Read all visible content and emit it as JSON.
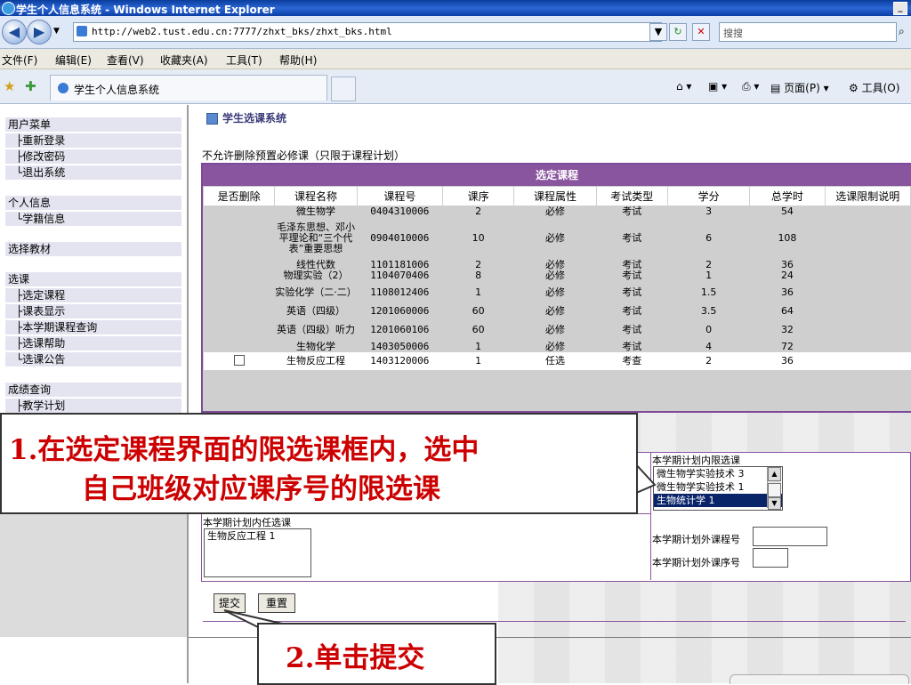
{
  "window": {
    "title": "学生个人信息系统 - Windows Internet Explorer"
  },
  "address": {
    "url": "http://web2.tust.edu.cn:7777/zhxt_bks/zhxt_bks.html",
    "search_placeholder": "搜搜"
  },
  "menubar": [
    "文件(F)",
    "编辑(E)",
    "查看(V)",
    "收藏夹(A)",
    "工具(T)",
    "帮助(H)"
  ],
  "tab": {
    "label": "学生个人信息系统"
  },
  "toolbar_right": {
    "page": "页面(P)",
    "tools": "工具(O)"
  },
  "sidebar": {
    "user_menu": "用户菜单",
    "relogin": "├重新登录",
    "change_pwd": "├修改密码",
    "logout": "└退出系统",
    "personal": "个人信息",
    "roll": "└学籍信息",
    "textbook": "选择教材",
    "course_select": "选课",
    "selected": "├选定课程",
    "timetable": "├课表显示",
    "term_query": "├本学期课程查询",
    "help": "├选课帮助",
    "notice": "└选课公告",
    "grades": "成绩查询",
    "plan": "├教学计划"
  },
  "main": {
    "section_title": "学生选课系统",
    "note": "不允许删除预置必修课（只限于课程计划）",
    "table_caption": "选定课程",
    "headers": [
      "是否删除",
      "课程名称",
      "课程号",
      "课序",
      "课程属性",
      "考试类型",
      "学分",
      "总学时",
      "选课限制说明"
    ],
    "rows": [
      {
        "name": "微生物学",
        "code": "0404310006",
        "seq": "2",
        "attr": "必修",
        "exam": "考试",
        "credit": "3",
        "hours": "54"
      },
      {
        "name": "毛泽东思想、邓小平理论和“三个代表”重要思想",
        "code": "0904010006",
        "seq": "10",
        "attr": "必修",
        "exam": "考试",
        "credit": "6",
        "hours": "108"
      },
      {
        "name": "线性代数",
        "code": "1101181006",
        "seq": "2",
        "attr": "必修",
        "exam": "考试",
        "credit": "2",
        "hours": "36"
      },
      {
        "name": "物理实验（2）",
        "code": "1104070406",
        "seq": "8",
        "attr": "必修",
        "exam": "考试",
        "credit": "1",
        "hours": "24"
      },
      {
        "name": "实验化学（二·二）",
        "code": "1108012406",
        "seq": "1",
        "attr": "必修",
        "exam": "考试",
        "credit": "1.5",
        "hours": "36"
      },
      {
        "name": "英语（四级）",
        "code": "1201060006",
        "seq": "60",
        "attr": "必修",
        "exam": "考试",
        "credit": "3.5",
        "hours": "64"
      },
      {
        "name": "英语（四级）听力",
        "code": "1201060106",
        "seq": "60",
        "attr": "必修",
        "exam": "考试",
        "credit": "0",
        "hours": "32"
      },
      {
        "name": "生物化学",
        "code": "1403050006",
        "seq": "1",
        "attr": "必修",
        "exam": "考试",
        "credit": "4",
        "hours": "72"
      },
      {
        "name": "生物反应工程",
        "code": "1403120006",
        "seq": "1",
        "attr": "任选",
        "exam": "考查",
        "credit": "2",
        "hours": "36"
      }
    ]
  },
  "form": {
    "limited_label": "本学期计划内限选课",
    "limited_options": [
      "微生物学实验技术 3",
      "微生物学实验技术 1",
      "生物统计学 1"
    ],
    "elective_label": "本学期计划内任选课",
    "elective_options": [
      "生物反应工程 1"
    ],
    "outside_code_label": "本学期计划外课程号",
    "outside_seq_label": "本学期计划外课序号",
    "submit": "提交",
    "reset": "重置"
  },
  "callouts": {
    "step1_line1": "1.在选定课程界面的限选课框内，选中",
    "step1_line2": "自己班级对应课序号的限选课",
    "step2": "2.单击提交"
  }
}
